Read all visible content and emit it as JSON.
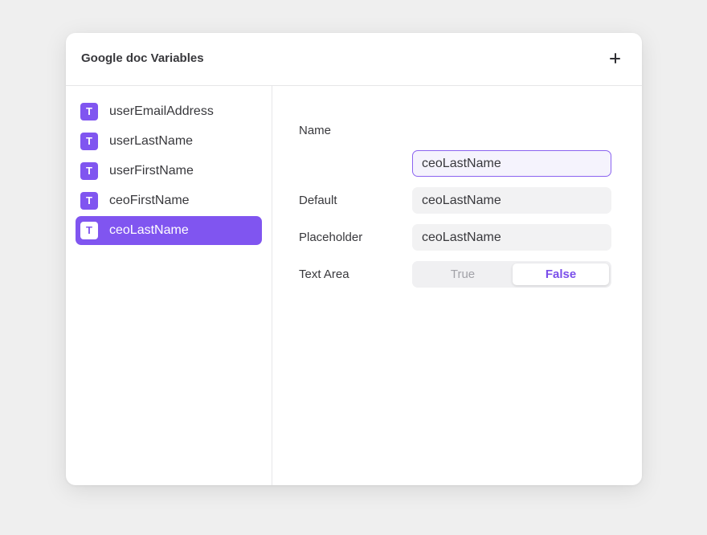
{
  "panel": {
    "title": "Google doc Variables",
    "add_icon": "plus-icon"
  },
  "variables": [
    {
      "label": "userEmailAddress",
      "type_badge": "T",
      "active": false
    },
    {
      "label": "userLastName",
      "type_badge": "T",
      "active": false
    },
    {
      "label": "userFirstName",
      "type_badge": "T",
      "active": false
    },
    {
      "label": "ceoFirstName",
      "type_badge": "T",
      "active": false
    },
    {
      "label": "ceoLastName",
      "type_badge": "T",
      "active": true
    }
  ],
  "detail": {
    "name_label": "Name",
    "name_value": "ceoLastName",
    "default_label": "Default",
    "default_value": "ceoLastName",
    "placeholder_label": "Placeholder",
    "placeholder_value": "ceoLastName",
    "text_area_label": "Text Area",
    "text_area_options": [
      "True",
      "False"
    ],
    "text_area_selected": "False"
  },
  "colors": {
    "accent": "#8055f0",
    "background": "#efefef",
    "panel": "#ffffff"
  }
}
